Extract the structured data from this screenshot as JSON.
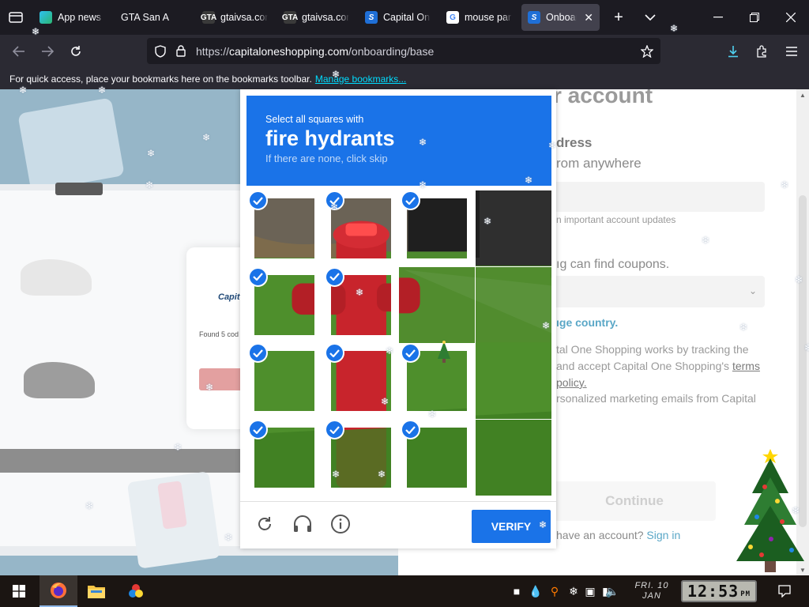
{
  "browser": {
    "tabs": [
      {
        "label": "App news",
        "favicon": "app-news-icon",
        "active": false
      },
      {
        "label": "GTA San A",
        "favicon": "none",
        "active": false
      },
      {
        "label": "gtaivsa.cor",
        "favicon": "gtaivsa-icon",
        "active": false
      },
      {
        "label": "gtaivsa.cor",
        "favicon": "gtaivsa-icon",
        "active": false
      },
      {
        "label": "Capital On",
        "favicon": "capital-one-shopping-icon",
        "active": false
      },
      {
        "label": "mouse par",
        "favicon": "google-icon",
        "active": false
      },
      {
        "label": "Onboardi",
        "favicon": "capital-one-shopping-icon",
        "active": true
      }
    ],
    "favicon_text": {
      "gta": "GTA",
      "s": "S",
      "g": "G"
    },
    "url": {
      "scheme": "https://",
      "host": "capitaloneshopping.com",
      "path": "/onboarding/base"
    },
    "bookmarks_bar": {
      "text": "For quick access, place your bookmarks here on the bookmarks toolbar.",
      "link": "Manage bookmarks..."
    }
  },
  "captcha": {
    "prompt": "Select all squares with",
    "target": "fire hydrants",
    "hint": "If there are none, click skip",
    "grid_rows": 4,
    "grid_cols": 4,
    "selected": [
      [
        true,
        true,
        true,
        false
      ],
      [
        true,
        true,
        false,
        false
      ],
      [
        true,
        true,
        true,
        false
      ],
      [
        true,
        true,
        true,
        false
      ]
    ],
    "verify_label": "VERIFY",
    "accent_color": "#1a73e8"
  },
  "form": {
    "heading": "r account",
    "email_label": "dress",
    "email_sub": "rom anywhere",
    "email_note": "n important account updates",
    "question": "ıg can find coupons.",
    "change_country": "ıge country.",
    "terms_lines": [
      "tal One Shopping works by tracking the",
      "and accept Capital One Shopping's",
      "terms",
      "policy."
    ],
    "marketing": "rsonalized marketing emails from Capital",
    "continue_label": "Continue",
    "signin_prefix": "have an account?",
    "signin_link": "Sign in",
    "link_color": "#5aa7c7"
  },
  "promo": {
    "card_logo": "Capit",
    "card_found": "Found 5 cod"
  },
  "taskbar": {
    "date_day": "FRI. 10",
    "date_month": "JAN",
    "time": "12:53",
    "ampm": "PM"
  }
}
